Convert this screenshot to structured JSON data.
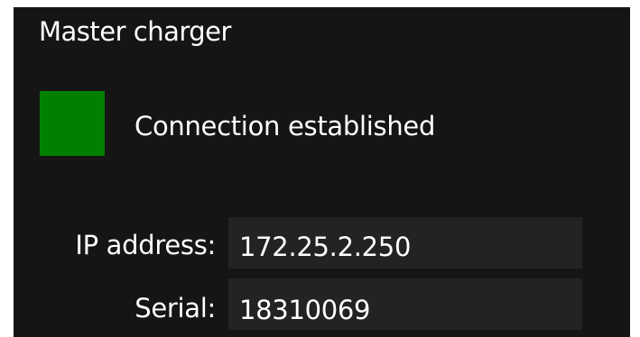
{
  "panel": {
    "title": "Master charger",
    "status": {
      "text": "Connection established",
      "color": "#008000"
    },
    "fields": {
      "ip_label": "IP address:",
      "ip_value": "172.25.2.250",
      "serial_label": "Serial:",
      "serial_value": "18310069"
    }
  }
}
